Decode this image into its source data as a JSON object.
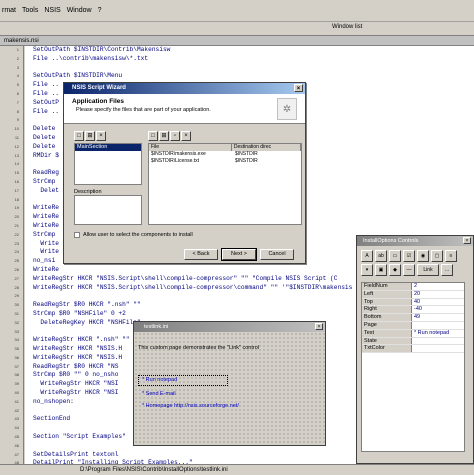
{
  "menubar": [
    "rmat",
    "Tools",
    "NSIS",
    "Window",
    "?"
  ],
  "toolbar": {
    "window_list": "Window list"
  },
  "editor": {
    "tab_title": "makensis.nsi",
    "lines": [
      "SetOutPath $INSTDIR\\Contrib\\Makensisw",
      "File ..\\contrib\\makensisw\\*.txt",
      "",
      "SetOutPath $INSTDIR\\Menu",
      "File ..",
      "File ..",
      "SetOutP",
      "File ..",
      "",
      "Delete",
      "Delete",
      "Delete",
      "RMDir $",
      "",
      "ReadReg",
      "StrCmp",
      "  Delet",
      "",
      "WriteRe",
      "WriteRe",
      "WriteRe",
      "StrCmp",
      "  Write",
      "  Write",
      "no_nsi",
      "WriteRe",
      "WriteRegStr HKCR \"NSIS.Script\\shell\\compile-compressor\" \"\" \"Compile NSIS Script (C",
      "WriteRegStr HKCR \"NSIS.Script\\shell\\compile-compressor\\command\" \"\" '\"$INSTDIR\\makensis",
      "",
      "ReadRegStr $R0 HKCR \".nsh\" \"\"",
      "StrCmp $R0 \"NSHFile\" 0 +2",
      "  DeleteRegKey HKCR \"NSHFile\"",
      "",
      "WriteRegStr HKCR \".nsh\" \"\"",
      "WriteRegStr HKCR \"NSIS.H",
      "WriteRegStr HKCR \"NSIS.H",
      "ReadRegStr $R0 HKCR \"NS",
      "StrCmp $R0 \"\" 0 no_nsho",
      "  WriteRegStr HKCR \"NSI",
      "  WriteRegStr HKCR \"NSI",
      "no_nshopen:",
      "",
      "SectionEnd",
      "",
      "Section \"Script Examples\"",
      "",
      "SetDetailsPrint textonl",
      "DetailPrint \"Installing Script Examples...\""
    ],
    "line_numbers": [
      "1",
      "2",
      "3",
      "4",
      "5",
      "6",
      "7",
      "8",
      "9",
      "10",
      "11",
      "12",
      "13",
      "14",
      "15",
      "16",
      "17",
      "18",
      "19",
      "20",
      "21",
      "22",
      "23",
      "24",
      "25",
      "26",
      "27",
      "28",
      "29",
      "30",
      "31",
      "32",
      "33",
      "34",
      "35",
      "36",
      "37",
      "38",
      "39",
      "40",
      "41",
      "42",
      "43",
      "44",
      "45",
      "46",
      "47",
      "48"
    ]
  },
  "status": {
    "path": "D:\\Program Files\\NSIS\\Contrib\\InstallOptions\\testlink.ini"
  },
  "wizard": {
    "title": "NSIS Script Wizard",
    "header_title": "Application Files",
    "header_subtitle": "Please specify the files that are part of your application.",
    "tree_item": "MainSection",
    "description_label": "Description",
    "file_col": "File",
    "dest_col": "Destination direc",
    "files": [
      {
        "file": "$INSTDIR\\makensis.exe",
        "dest": "$INSTDIR"
      },
      {
        "file": "$INSTDIR\\License.txt",
        "dest": "$INSTDIR"
      }
    ],
    "allow_label": "Allow user to select the components to install",
    "back": "< Back",
    "next": "Next >",
    "cancel": "Cancel"
  },
  "testlink": {
    "title": "testlink.ini",
    "intro": "This custom page demonstrates the \"Link\" control",
    "link1": "* Run notepad",
    "link2": "* Send E-mail",
    "link3": "* Homepage http://nsis.sourceforge.net/"
  },
  "ioc": {
    "title": "InstallOptions Controls",
    "tool_link": "Link",
    "props": [
      {
        "k": "FieldNum",
        "v": "2"
      },
      {
        "k": "Left",
        "v": "20"
      },
      {
        "k": "Top",
        "v": "40"
      },
      {
        "k": "Right",
        "v": "-40"
      },
      {
        "k": "Bottom",
        "v": "49"
      },
      {
        "k": "Page",
        "v": ""
      },
      {
        "k": "Text",
        "v": "* Run notepad"
      },
      {
        "k": "State",
        "v": ""
      },
      {
        "k": "TxtColor",
        "v": ""
      }
    ]
  }
}
